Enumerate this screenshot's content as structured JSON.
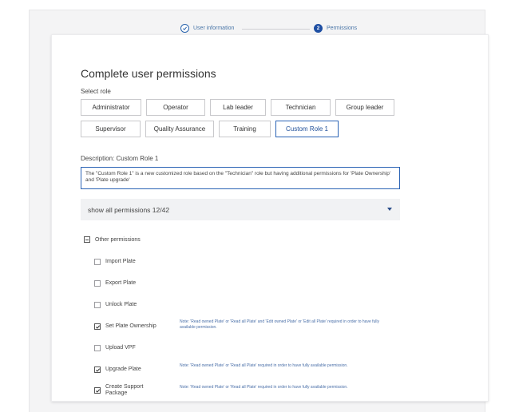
{
  "stepper": {
    "step1": {
      "label": "User information"
    },
    "step2": {
      "number": "2",
      "label": "Permissions"
    }
  },
  "form": {
    "title": "Complete user permissions",
    "select_role_label": "Select role",
    "roles_row1": [
      "Administrator",
      "Operator",
      "Lab leader",
      "Technician",
      "Group leader"
    ],
    "roles_row2": [
      "Supervisor",
      "Quality Assurance",
      "Training",
      "Custom Role 1"
    ],
    "selected_role": "Custom Role 1",
    "description_label": "Description: Custom Role 1",
    "description_text": "The \"Custom Role 1\" is a new customized role based on the \"Technician\" role but having additional permissions for 'Plate Ownership' and 'Plate upgrade'",
    "permissions_toggle": "show all permissions 12/42",
    "group_label": "Other permissions",
    "permissions": [
      {
        "label": "Import Plate",
        "checked": false,
        "note": ""
      },
      {
        "label": "Export Plate",
        "checked": false,
        "note": ""
      },
      {
        "label": "Unlock Plate",
        "checked": false,
        "note": ""
      },
      {
        "label": "Set Plate Ownership",
        "checked": true,
        "note": "Note: 'Read owned Plate' or 'Read all Plate' and 'Edit owned Plate' or 'Edit all Plate' required in order to have fully available permission."
      },
      {
        "label": "Upload VPF",
        "checked": false,
        "note": ""
      },
      {
        "label": "Upgrade Plate",
        "checked": true,
        "note": "Note: 'Read owned Plate' or 'Read all Plate' required in order to have fully available permission."
      },
      {
        "label": "Create Support Package",
        "checked": true,
        "note": "Note: 'Read owned Plate' or 'Read all Plate' required in order to have fully available permission."
      }
    ]
  },
  "colors": {
    "accent": "#2b63b5",
    "note_text": "#4a6fa8",
    "panel_bg": "#f4f4f5"
  }
}
